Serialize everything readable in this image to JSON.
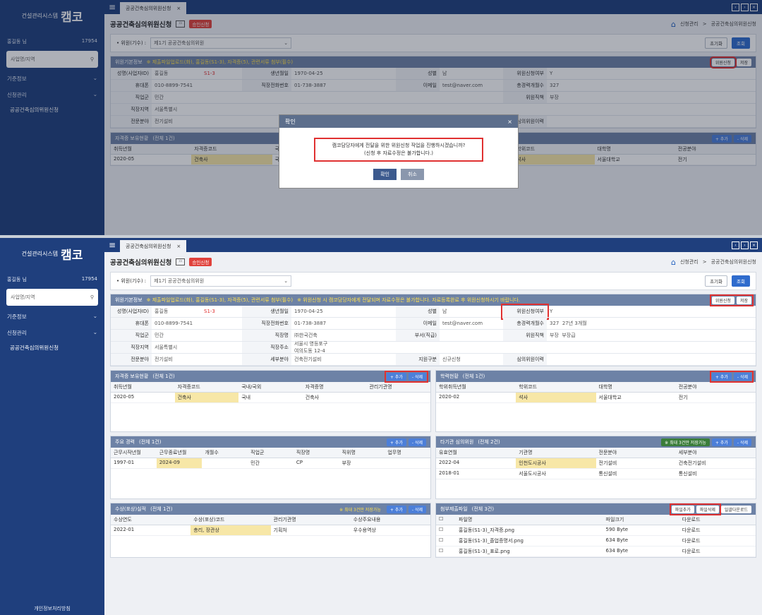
{
  "app": {
    "system_name": "건설관리시스템",
    "brand": "캠코",
    "user": "홍길동 님",
    "session": "17954",
    "search_placeholder": "사업명/지역",
    "menu": [
      {
        "label": "기준정보"
      },
      {
        "label": "신청관리"
      }
    ],
    "submenu": "공공건축심의위원신청",
    "footer": "개인정보처리방침"
  },
  "tabs": {
    "active": "공공건축심의위원신청"
  },
  "page": {
    "title": "공공건축심의위원신청",
    "status_badge": "승인신청",
    "breadcrumb": [
      "신청관리",
      "공공건축심의위원신청"
    ]
  },
  "filter": {
    "label": "• 위원(기수) :",
    "value": "제1기 공공건축심의위원",
    "reset": "초기화",
    "search": "조회"
  },
  "basic": {
    "title": "위원기본정보",
    "note": "※ 제출파일업로드(화), 홍길동(S1-3), 자격증(5), 관련서류 첨부(필수)",
    "note2": "※ 위원신청 시 캠코담당자에게 전달되며 자료수정은 불가합니다. 자료등록완료 후 위원신청하시기 바랍니다.",
    "apply_btn": "위원신청",
    "save_btn": "저장",
    "fields": {
      "name_label": "성명(사업자ID)",
      "name": "홍길동",
      "id": "S1-3",
      "birth_label": "생년월일",
      "birth": "1970-04-25",
      "gender_label": "성별",
      "gender": "남",
      "approve_label": "위원신청여부",
      "approve": "Y",
      "phone_label": "휴대폰",
      "phone": "010-8899-7541",
      "tel_label": "직장전화번호",
      "tel": "01-738-3887",
      "email_label": "이메일",
      "email": "test@naver.com",
      "career_label": "총경력개월수",
      "career": "327",
      "career_note": "27년 3개월",
      "type_label": "직업군",
      "type": "민간",
      "work_label": "직장명",
      "work": "㈜한국건축",
      "dept_label": "부서(직급)",
      "rank_label": "위원직책",
      "rank": "부장",
      "rank2": "부장급",
      "region_label": "직장지역",
      "region": "서울특별시",
      "addr_label": "직장주소",
      "addr": "서울시 영등포구 여의도동 12-4",
      "field_label": "전문분야",
      "field": "전기설비",
      "sub_label": "세부분야",
      "sub": "건축전기설비",
      "apply_type_label": "지원구분",
      "apply_type": "신규신청",
      "cmt_label": "심의위원이력"
    }
  },
  "licenses": {
    "title": "자격증 보유현황",
    "count": "(전체 1건)",
    "headers": [
      "취득년월",
      "자격증코드",
      "국내/국외",
      "자격증명",
      "관리기관명"
    ],
    "rows": [
      [
        "2020-05",
        "건축사",
        "국내",
        "건축사",
        ""
      ]
    ]
  },
  "edu": {
    "title": "학력현황",
    "count": "(전체 1건)",
    "headers": [
      "학위취득년월",
      "학위코드",
      "대학명",
      "전공분야"
    ],
    "rows": [
      [
        "2020-02",
        "석사",
        "서울대학교",
        "전기"
      ]
    ]
  },
  "careers": {
    "title": "주요 경력",
    "count": "(전체 1건)",
    "headers": [
      "근무시작년월",
      "근무종료년월",
      "개월수",
      "직업군",
      "직장명",
      "직위명",
      "업무명"
    ],
    "rows": [
      [
        "1997-01",
        "2024-09",
        "",
        "민간",
        "CP",
        "부장",
        ""
      ]
    ]
  },
  "committees": {
    "title": "타기관 심의위원",
    "count": "(전체 2건)",
    "note": "※ 최대 3건만 저장가능",
    "headers": [
      "유효연월",
      "기관명",
      "전문분야",
      "세부분야"
    ],
    "rows": [
      [
        "2022-04",
        "인천도시공사",
        "전기설비",
        "건축전기설비"
      ],
      [
        "2018-01",
        "서울도시공사",
        "통신설비",
        "통신설비"
      ]
    ]
  },
  "awards": {
    "title": "수상(포상)실적",
    "count": "(전체 1건)",
    "note": "※ 최대 3건만 저장가능",
    "headers": [
      "수상연도",
      "수상(포상)코드",
      "관리기관명",
      "수상주요내용"
    ],
    "rows": [
      [
        "2022-01",
        "총리, 장관상",
        "기획처",
        "우수용역상"
      ]
    ]
  },
  "files": {
    "title": "첨부제출파일",
    "count": "(전체 3건)",
    "btn_upload": "파일추가",
    "btn_delete": "파일삭제",
    "btn_download": "일괄다운로드",
    "headers": [
      "파일명",
      "파일크기",
      "다운로드"
    ],
    "rows": [
      [
        "홍길동(S1-3)_자격증.png",
        "590 Byte",
        "다운로드"
      ],
      [
        "홍길동(S1-3)_졸업증명서.png",
        "634 Byte",
        "다운로드"
      ],
      [
        "홍길동(S1-3)_표로.png",
        "634 Byte",
        "다운로드"
      ]
    ]
  },
  "actions": {
    "add": "+ 추가",
    "del": "- 삭제"
  },
  "modal": {
    "title": "확인",
    "message1": "캠코담당자에게 전달을 위한 위원신청 작업을 진행하시겠습니까?",
    "message2": "(신청 후 자료수정은 불가합니다.)",
    "ok": "확인",
    "cancel": "취소"
  }
}
